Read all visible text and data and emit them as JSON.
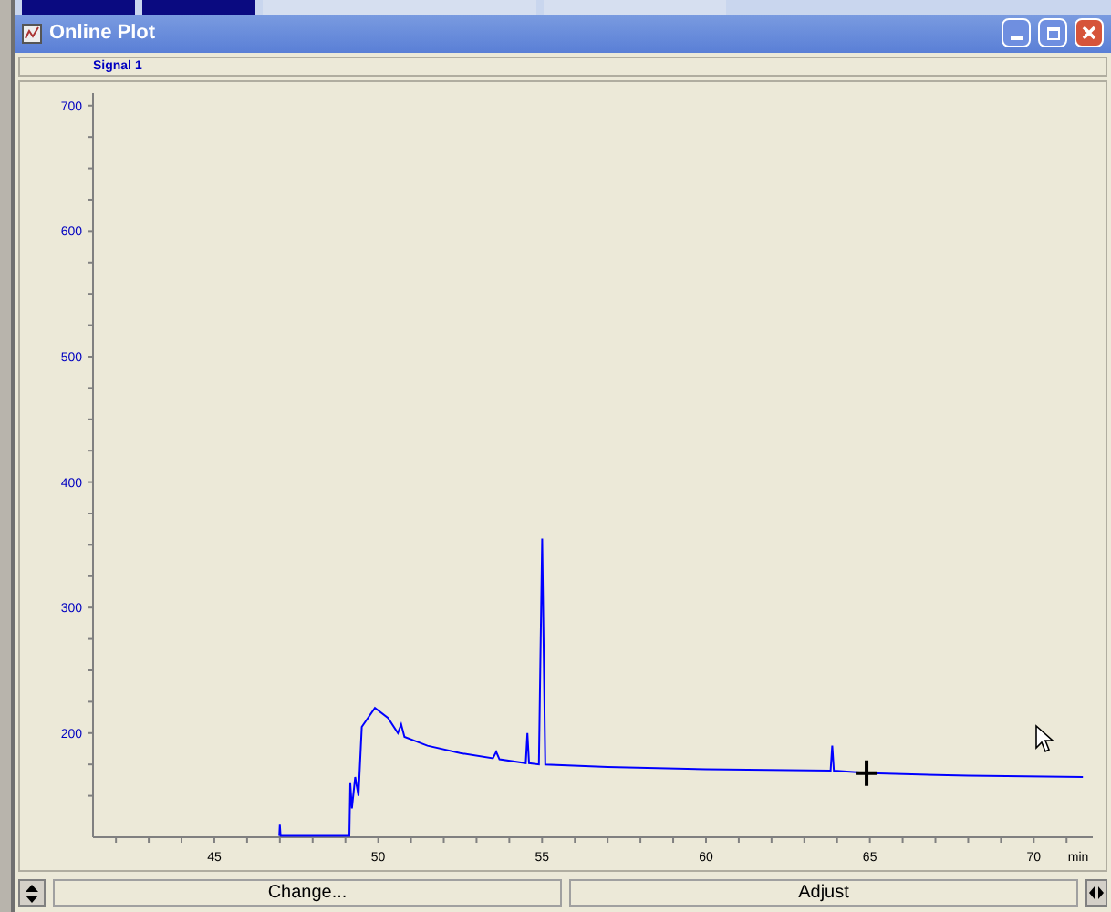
{
  "window": {
    "title": "Online Plot"
  },
  "plot": {
    "chart_data": {
      "type": "line",
      "xlabel": "min",
      "xlim": [
        41.3,
        71.8
      ],
      "ylim": [
        117,
        710
      ],
      "xticks": [
        45,
        50,
        55,
        60,
        65,
        70
      ],
      "yticks": [
        200,
        300,
        400,
        500,
        600,
        700
      ],
      "x": [
        46.98,
        47.0,
        47.02,
        49.12,
        49.15,
        49.2,
        49.3,
        49.4,
        49.5,
        49.9,
        50.3,
        50.6,
        50.7,
        50.8,
        51.5,
        52.5,
        53.5,
        53.6,
        53.7,
        54.5,
        54.55,
        54.6,
        54.9,
        55.0,
        55.1,
        57,
        60,
        63.8,
        63.85,
        63.9,
        65,
        68,
        71.5
      ],
      "series": [
        {
          "name": "Signal 1",
          "color": "#0000ff",
          "values": [
            118,
            127,
            118,
            118,
            160,
            140,
            165,
            150,
            205,
            220,
            212,
            200,
            207,
            197,
            190,
            184,
            180,
            185,
            179,
            176,
            200,
            176,
            175,
            355,
            175,
            173,
            171,
            170,
            190,
            170,
            168,
            166,
            165
          ]
        }
      ]
    }
  },
  "buttons": [
    {
      "label": "Change..."
    },
    {
      "label": "Adjust"
    }
  ]
}
